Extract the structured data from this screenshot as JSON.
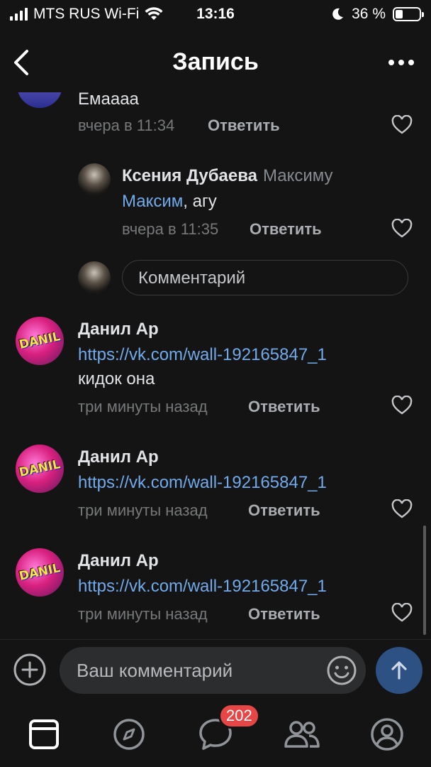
{
  "status_bar": {
    "carrier": "MTS RUS Wi-Fi",
    "time": "13:16",
    "battery": "36 %",
    "battery_level": 0.36
  },
  "nav": {
    "title": "Запись"
  },
  "comments": {
    "top": {
      "text_fragment": "Емаааа",
      "time": "вчера в 11:34",
      "reply_label": "Ответить"
    },
    "kseniya": {
      "author": "Ксения Дубаева",
      "reply_to": "Максиму",
      "mention": "Максим",
      "text": ", агу",
      "time": "вчера в 11:35",
      "reply_label": "Ответить"
    },
    "reply_input_placeholder": "Комментарий",
    "danil": [
      {
        "author": "Данил Ар",
        "link": "https://vk.com/wall-192165847_1",
        "text": "кидок она",
        "time": "три минуты назад",
        "reply_label": "Ответить"
      },
      {
        "author": "Данил Ар",
        "link": "https://vk.com/wall-192165847_1",
        "text": "",
        "time": "три минуты назад",
        "reply_label": "Ответить"
      },
      {
        "author": "Данил Ар",
        "link": "https://vk.com/wall-192165847_1",
        "text": "",
        "time": "три минуты назад",
        "reply_label": "Ответить"
      }
    ],
    "avatar_text": "DANIL"
  },
  "composer": {
    "placeholder": "Ваш комментарий"
  },
  "tabbar": {
    "messages_badge": "202"
  },
  "colors": {
    "background": "#141414",
    "link": "#71aaeb",
    "badge": "#e64646",
    "send_button": "#2d5182"
  }
}
